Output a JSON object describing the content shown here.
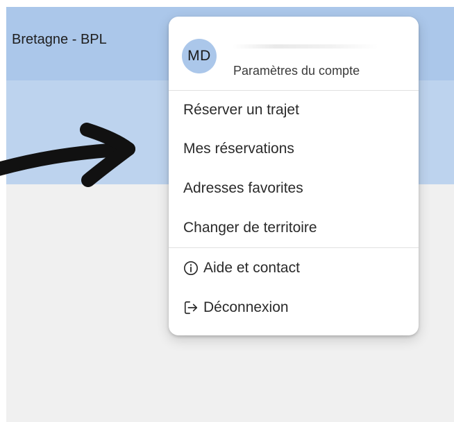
{
  "header": {
    "territory": "Bretagne - BPL"
  },
  "account_menu": {
    "avatar_initials": "MD",
    "account_settings_label": "Paramètres du compte",
    "items": [
      {
        "label": "Réserver un trajet",
        "icon": null
      },
      {
        "label": "Mes réservations",
        "icon": null
      },
      {
        "label": "Adresses favorites",
        "icon": null
      },
      {
        "label": "Changer de territoire",
        "icon": null
      }
    ],
    "secondary_items": [
      {
        "label": "Aide et contact",
        "icon": "info-icon"
      },
      {
        "label": "Déconnexion",
        "icon": "logout-icon"
      }
    ]
  },
  "colors": {
    "top_bar": "#abc7ea",
    "sub_band": "#bdd3ee",
    "content_bg": "#f0f0f0",
    "avatar_bg": "#abc7ea",
    "annotation_arrow": "#111111"
  }
}
